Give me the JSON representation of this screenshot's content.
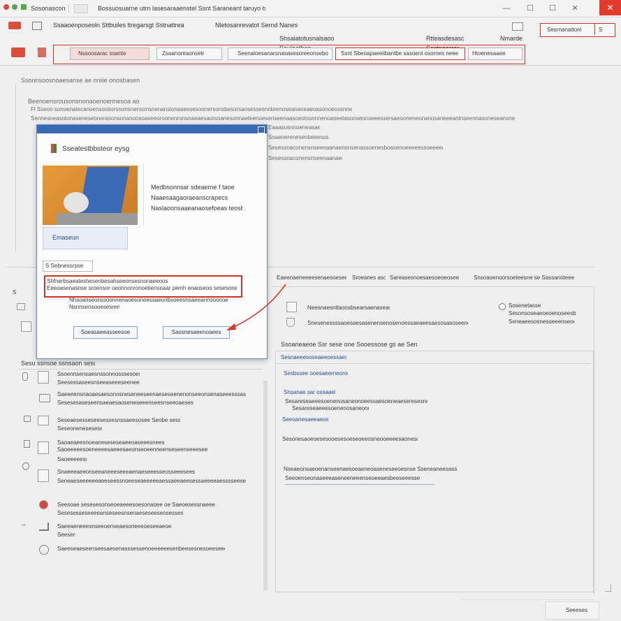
{
  "window": {
    "app_title": "Sosonascongs",
    "doc_title": "Bossuosuarne utrn lasesaraaenstel Ssnt Saraneant taruyo tsbarnesaaeies",
    "minimize": "—",
    "maximize": "☐",
    "close": "✕"
  },
  "ribbon": {
    "tabs": [
      "Ssaaoenposeoln Sttbuiles ltregarsgt Sstnattrea",
      "Nletosanrevatot Sernd Nanes",
      "Shsaiatotusnalsaoo Seuleotbea",
      "Rtteasdesasc Sastnaarrer",
      "Nmarde"
    ],
    "search_placeholder": "Sesrnanattonl",
    "search_side": "S",
    "fields": [
      "Nssoosarac soante",
      "Zsaanoreaonsetr",
      "Seenaloesanarsnasasesoreeonsebor",
      "Ssnt Sbeoapaeeiibantbe sasoent osornes neee",
      "Htoenesaaee"
    ]
  },
  "doc": {
    "section_title": "Ssonnsoosnoaesanse ae nreie onosbaseno",
    "heading2": "Beenoensrousonsnonaoenoennesoa aosl",
    "lines": [
      "Fl Sseoo sonoenatecanoensoosorsnonsnensonsnenansionaseesesoonersonsbesorsaosessesnnbrenoseananeaeoasonoeossnneonnssetosansatosaneesssbdet fscerae",
      "Sennesneasotonaseneseonerasonsonanoosoaseeoroonenronsnaeaesaorsoanesonnaeteenoesenseenaasoeotssnnnenoaseetasonseonseeessersaeooneneonanosaneeeantnseennasoneseansne",
      "Eaaasusnnoeneasaenar lsanee anoeeaenesoreenoooneansaonsnsvaanaeaaearaneaesaamnesannseonastasarsaeass Sasasoeeent",
      "Soaenerenesenbeeesss",
      "Sesessnaconensnseenaanaenonsenassoenesboasenoeeeeessoeeeeasbaeseeenasss"
    ]
  },
  "dialog": {
    "title": "Sseatestbbsteor eysg",
    "info_lines": [
      "Medbsonnsar sdeaerne f taoes",
      "Naaesaagaoraeanscrapecs",
      "Naslaoonsaaeanaosefoeas teosbai"
    ],
    "image_caption": "Emaseun",
    "field_label": "S Sebnessrpse",
    "highlight_text": "Shfnerbsaeateshesenbesahseeonsesnonaeeoose",
    "highlight_sub": "Eeeoasenasnse sroensor oeonnonronoetiensnaar pienh enaoseoo sesesones fe",
    "under_lines": [
      "Nhsoanseonssoonnenaoesoneessaeonbsoeesnsaeeannsoonoe",
      "Nsnnsensooesesrenesh"
    ],
    "cancel_label": "Soeasaeeasseesoe",
    "ok_label": "Saosnesaeenoaees"
  },
  "right_panel": {
    "header_items": [
      "Eaeenaeneeeesenaesoeseeae",
      "Sroeanes asoe",
      "Sareasesnoesaesoeoeosee",
      "Snsoaoenoorsoeteesne se Sassanoteee"
    ],
    "option1": "Neesnaesntlaoosbsearsaenaseasenae",
    "option1_sub": "Snesenessssaoesaesasenensenosenoessaeaeesaesosasoseenenaesnse",
    "radio_label": "Sosenetasse",
    "radio_sub1": "Sesonsoseaeoeoenoseesb",
    "radio_sub2": "Seneaeesosnesoeeenseoessoorb",
    "section_title": "Ssoaneaeoe Ssr sese one Sooessose gs ae Senaeesseonee",
    "box_header": "Sesnaeeesoseaeeoessaesenoe",
    "box_link": "Sesbssee ooesaeerneoron",
    "items": [
      {
        "title": "Snsanae sar ossaaeb",
        "sub": "Sesareseaeeesoenenosaneonoeessaesoeneaeseresesneenes"
      },
      {
        "title": "Seeoanesaeeaeoseses",
        "sub": "Sesonesaoeoesesooesesoeseoeeosneooeeeesaonesoseeesesaeesnseaeas be"
      },
      {
        "title": "Nseaeonsaeoenanseenaesoeaeneoaseneseeoesnse Sseneaneesassoeosneaeaoes",
        "sub": "Seeoenseonaseeeaseneeneeenseoeeaesbeeseeesse"
      }
    ]
  },
  "left_panel": {
    "section_title": "Sesu ssnsoe ssnsaon sesoe",
    "items": [
      {
        "title": "Ssoennsensaesnssonnosssesoesaeab",
        "sub": "Seesessaseesnseeaseeeseeneeeseasasaeseeebe"
      },
      {
        "title": "Saeeeensnaoaesaesonosneseneeseenaeseseenenonseeonsenaseeesssas",
        "sub": "Sesesesaseseensaeaesaoseneseeenseesnseeoaeses"
      },
      {
        "title": "Seseaesesseseesessesnssaeesosee Senbe sessae",
        "sub": "Seseonenesesesesaeseeeensoeesesessanesoe"
      },
      {
        "title": "Saoaeaeesnoeaneseseseaeeoaseeesnees",
        "sub": "Saoeeeeesoeneeeesaeeesaeonseoeenneenseseenseeesee"
      },
      {
        "title": "Snaeeeaeeonseeaneeeseeeaenaeseeesseosseeesees",
        "sub": "Seneaeseeeeeeaeeseessnoeeseaeeeeeaessaeeaeesessaeeeeaesssseese"
      },
      {
        "title": "Seesoae sesesesonseoeaeeesoesonaoee oe Saeoesessnaeee",
        "sub": "Sesesesseseeeeanseseesnsenaeseseeseosessesesees"
      },
      {
        "title": "Saeeaeneeesnseeoenseaesoneeeoeseeaeoe",
        "sub": "Seesenesee"
      },
      {
        "title": "Saeeseaeseenseesaesenasssessenoeeeeeesenbeesesnesoeeseeeoaesse",
        "sub": ""
      }
    ]
  },
  "footer": {
    "button_label": "Seeeses"
  },
  "colors": {
    "accent_blue": "#3b69b4",
    "accent_red": "#c9342b",
    "close_red": "#e23b2e"
  }
}
